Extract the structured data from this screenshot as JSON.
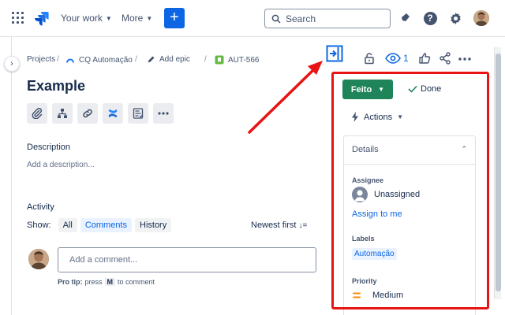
{
  "nav": {
    "your_work": "Your work",
    "more": "More",
    "create": "+",
    "search_placeholder": "Search"
  },
  "breadcrumb": {
    "projects": "Projects",
    "project": "CQ Automação",
    "add_epic": "Add epic",
    "issue_key": "AUT-566"
  },
  "issue": {
    "title": "Example",
    "watchers": "1"
  },
  "description": {
    "label": "Description",
    "placeholder": "Add a description..."
  },
  "activity": {
    "label": "Activity",
    "show_label": "Show:",
    "filters": [
      "All",
      "Comments",
      "History"
    ],
    "active_filter": "Comments",
    "sort": "Newest first",
    "comment_placeholder": "Add a comment...",
    "protip_prefix": "Pro tip:",
    "protip_press": "press",
    "protip_key": "M",
    "protip_suffix": "to comment"
  },
  "panel": {
    "status": "Feito",
    "done": "Done",
    "actions": "Actions",
    "details": "Details",
    "assignee_label": "Assignee",
    "assignee_value": "Unassigned",
    "assign_to_me": "Assign to me",
    "labels_label": "Labels",
    "label_value": "Automação",
    "priority_label": "Priority",
    "priority_value": "Medium"
  },
  "colors": {
    "brand": "#0c66e4",
    "status": "#1f845a",
    "highlight": "#e81313",
    "priority_medium": "#ff8b00"
  }
}
